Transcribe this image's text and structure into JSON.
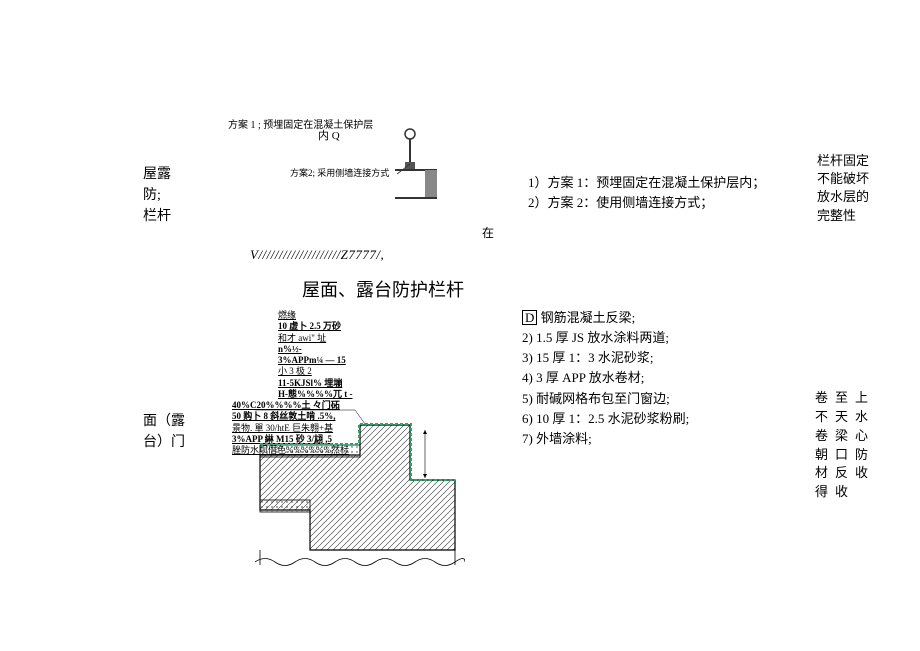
{
  "section1": {
    "leftLabel": {
      "line1": "屋露",
      "line2": "防;",
      "line3": "栏杆"
    },
    "plan1": "方案 1 ; 预埋固定在混凝土保护层",
    "plan1_inner": "内 Q",
    "plan2": "方案2; 采用侧墙连接方式",
    "at": "在",
    "list": {
      "item1": "1）方案 1：预埋固定在混凝土保护层内；",
      "item2": "2）方案 2：使用侧墙连接方式；"
    },
    "rightNote": {
      "line1": "栏杆固定",
      "line2": "不能破坏",
      "line3": "放水层的",
      "line4": "完整性"
    }
  },
  "pattern": "V////////////////////Z7777/,",
  "mainTitle": "屋面、露台防护栏杆",
  "section2": {
    "leftLabel": {
      "line1": "面（露",
      "line2": "台）门"
    },
    "annotations": {
      "l0": "燃缘",
      "l1": "10 虚卜 2.5 万砂",
      "l2": "和才 awi\" 址",
      "l3": "n%½-",
      "l4": "3%APPm¼ — 15",
      "l5": "小 3 极 2",
      "l6": "11-5KJSl% 埋塴",
      "l7": "H-態%%%%兀 t   ‐",
      "l8": "40%C20%%%%土 々门砳",
      "l9": "50 购卜 8 斜丝敦土啃 .5%,",
      "l10": "景物. 單 30/htE 巨朱翱+基",
      "l11": "3%APP 綝 M15 砂 3/翃 ,5",
      "l12": "脞防水坝僭色%%%%%%然标"
    },
    "listD": {
      "header": "D 钢筋混凝土反梁;",
      "item2": "2) 1.5 厚 JS 放水涂料两道;",
      "item3": "3) 15 厚 1：3 水泥砂浆;",
      "item4": "4) 3 厚 APP 放水卷材;",
      "item5": "5) 耐碱网格布包至门窗边;",
      "item6": "6) 10 厚 1：2.5 水泥砂浆粉刷;",
      "item7": "7) 外墙涂料;"
    },
    "rightCols": {
      "c1": "卷 不 卷 朝 材 得",
      "c2": "至 天 梁 口 反 收",
      "c3": "上 水 心 防 收"
    }
  }
}
